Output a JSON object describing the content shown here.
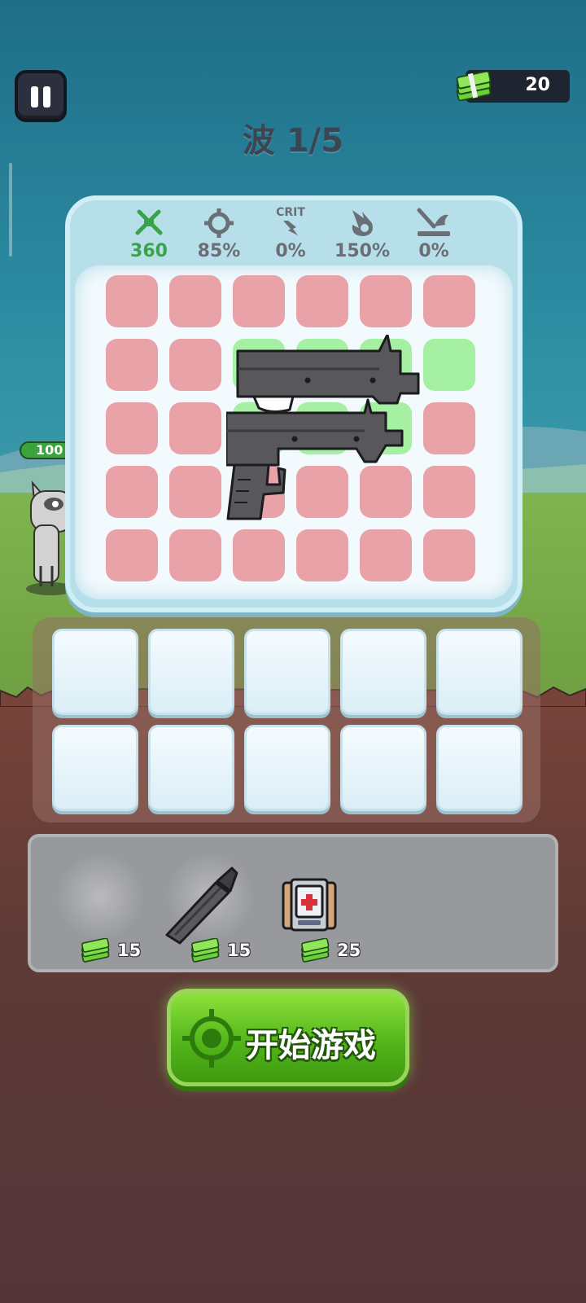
{
  "hud": {
    "cash_amount": "20",
    "wave_label": "波 1/5"
  },
  "enemy": {
    "hp_label": "100"
  },
  "stats": [
    {
      "icon": "sword-icon",
      "value": "360",
      "color": "#3aa34a"
    },
    {
      "icon": "crosshair-icon",
      "value": "85%",
      "color": "#6a6f76"
    },
    {
      "icon": "crit-icon",
      "label": "CRIT",
      "value": "0%",
      "color": "#6a6f76"
    },
    {
      "icon": "fire-damage-icon",
      "value": "150%",
      "color": "#6a6f76"
    },
    {
      "icon": "knockback-icon",
      "value": "0%",
      "color": "#6a6f76"
    }
  ],
  "grid": {
    "rows": 5,
    "cols": 6,
    "cell_colors": {
      "blocked": "#e8a2a8",
      "valid": "#a5f0a3"
    },
    "placed_item": "uzi-smg"
  },
  "inventory": {
    "slots": 10
  },
  "shop": {
    "items": [
      {
        "name": "empty",
        "price": "15"
      },
      {
        "name": "knife",
        "price": "15"
      },
      {
        "name": "medkit",
        "price": "25"
      }
    ]
  },
  "start_button": {
    "label": "开始游戏",
    "icon": "target-icon",
    "color": "#52b61a"
  }
}
